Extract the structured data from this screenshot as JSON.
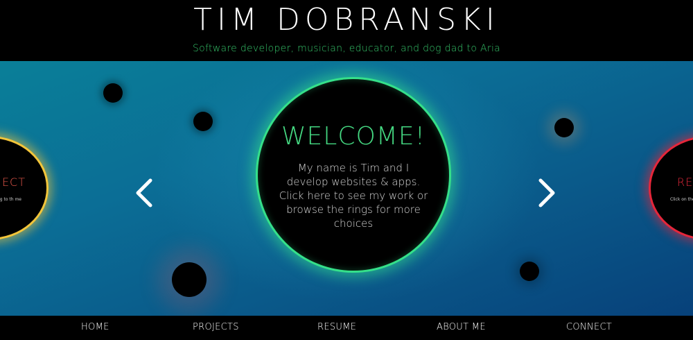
{
  "header": {
    "title": "TIM DOBRANSKI",
    "tagline": "Software developer, musician, educator, and dog dad to Aria"
  },
  "carousel": {
    "center": {
      "heading": "WELCOME!",
      "body": "My name is Tim and I develop websites & apps. Click here to see my work or browse the rings for more choices",
      "ring_color": "#35e08a"
    },
    "left": {
      "heading": "NECT",
      "body": "ring to th me",
      "ring_color": "#f3c53a"
    },
    "right": {
      "heading": "RES",
      "body": "Click on the expan",
      "ring_color": "#e5263a"
    },
    "prev_icon": "chevron-left-icon",
    "next_icon": "chevron-right-icon"
  },
  "nav": {
    "items": [
      {
        "label": "HOME"
      },
      {
        "label": "PROJECTS"
      },
      {
        "label": "RESUME"
      },
      {
        "label": "ABOUT ME"
      },
      {
        "label": "CONNECT"
      }
    ]
  },
  "colors": {
    "accent_green": "#35c56a",
    "background_top": "#0a7f98",
    "background_bottom": "#07417a"
  }
}
